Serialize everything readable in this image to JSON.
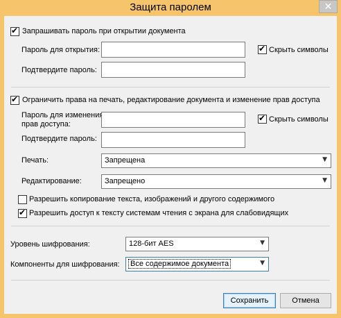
{
  "window": {
    "title": "Защита паролем",
    "close_glyph": "✕"
  },
  "open_section": {
    "require_password_label": "Запрашивать пароль при открытии документа",
    "require_password_checked": true,
    "open_password_label": "Пароль для открытия:",
    "confirm_password_label": "Подтвердите пароль:",
    "hide_symbols_label": "Скрыть символы",
    "hide_symbols_checked": true
  },
  "restrict_section": {
    "restrict_label": "Ограничить права на печать, редактирование документа и изменение прав доступа",
    "restrict_checked": true,
    "permissions_password_label_line1": "Пароль для изменения",
    "permissions_password_label_line2": "прав доступа:",
    "confirm_password_label": "Подтвердите пароль:",
    "hide_symbols_label": "Скрыть символы",
    "hide_symbols_checked": true,
    "print_label": "Печать:",
    "print_value": "Запрещена",
    "edit_label": "Редактирование:",
    "edit_value": "Запрещено",
    "allow_copy_label": "Разрешить копирование текста, изображений и другого содержимого",
    "allow_copy_checked": false,
    "allow_screenreader_label": "Разрешить доступ к тексту системам чтения с экрана для слабовидящих",
    "allow_screenreader_checked": true
  },
  "encryption": {
    "level_label": "Уровень шифрования:",
    "level_value": "128-бит AES",
    "components_label": "Компоненты для шифрования:",
    "components_value": "Все содержимое документа"
  },
  "buttons": {
    "save": "Сохранить",
    "cancel": "Отмена"
  },
  "icons": {
    "dropdown": "▼"
  }
}
